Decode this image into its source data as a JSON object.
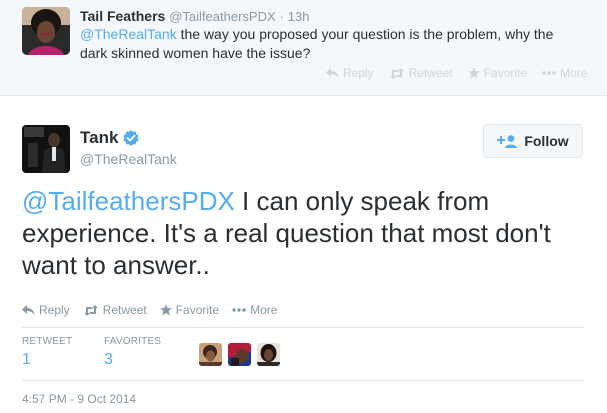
{
  "reply_tweet": {
    "name": "Tail Feathers",
    "handle": "@TailfeathersPDX",
    "separator": "·",
    "time": "13h",
    "mention": "@TheRealTank",
    "text": " the way you proposed your question is the problem, why the dark skinned women have the issue?",
    "actions": {
      "reply": "Reply",
      "retweet": "Retweet",
      "favorite": "Favorite",
      "more": "More"
    }
  },
  "main_tweet": {
    "name": "Tank",
    "verified_icon": "verified-badge-icon",
    "handle": "@TheRealTank",
    "follow_label": "Follow",
    "mention": "@TailfeathersPDX",
    "text": " I can only speak from experience. It's a real question that most don't want to answer..",
    "actions": {
      "reply": "Reply",
      "retweet": "Retweet",
      "favorite": "Favorite",
      "more": "More"
    },
    "stats": {
      "retweet_label": "RETWEET",
      "retweet_count": "1",
      "favorites_label": "FAVORITES",
      "favorites_count": "3"
    },
    "timestamp": "4:57 PM - 9 Oct 2014"
  },
  "colors": {
    "link": "#55acee",
    "verified": "#55acee",
    "muted": "#8899a6",
    "text": "#292f33"
  }
}
